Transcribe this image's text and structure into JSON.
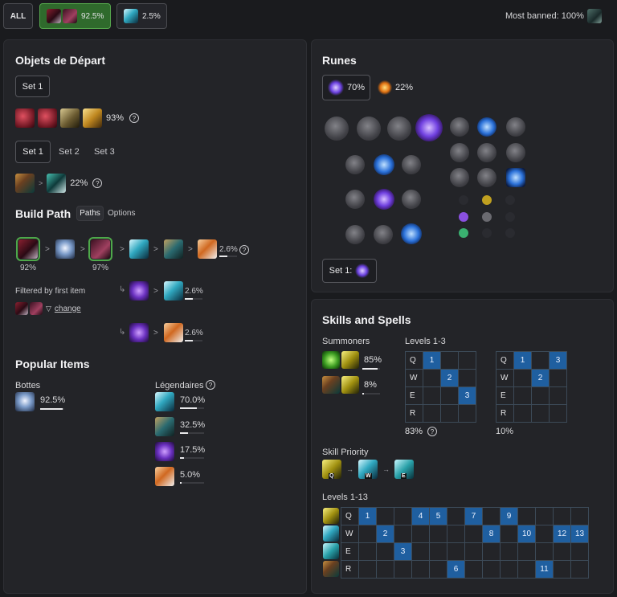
{
  "filters": {
    "all_label": "ALL",
    "filter1_pct": "92.5%",
    "filter2_pct": "2.5%",
    "most_banned": "Most banned: 100%"
  },
  "starting": {
    "title": "Objets de Départ",
    "set_button": "Set 1",
    "items_pct": "93%",
    "tabs": [
      "Set 1",
      "Set 2",
      "Set 3"
    ],
    "combo_pct": "22%",
    "combo_sep": ">"
  },
  "build": {
    "title": "Build Path",
    "tab_paths": "Paths",
    "tab_options": "Options",
    "pct1": "92%",
    "pct2": "97%",
    "main_pct": "2.6%",
    "sep": ">",
    "filtered_label": "Filtered by first item",
    "change": "change",
    "alt1_pct": "2.6%",
    "alt2_pct": "2.6%"
  },
  "popular": {
    "title": "Popular Items",
    "boots_title": "Bottes",
    "boots_pct": "92.5%",
    "legend_title": "Légendaires",
    "legend": [
      {
        "pct": "70.0%",
        "icon": "storm-blade-icon",
        "fill": 0.7
      },
      {
        "pct": "32.5%",
        "icon": "eel-blade-icon",
        "fill": 0.33
      },
      {
        "pct": "17.5%",
        "icon": "void-staff-icon",
        "fill": 0.18
      },
      {
        "pct": "5.0%",
        "icon": "guardian-angel-icon",
        "fill": 0.05
      }
    ]
  },
  "runes": {
    "title": "Runes",
    "page1_pct": "70%",
    "page2_pct": "22%",
    "set_label": "Set 1:"
  },
  "skills": {
    "title": "Skills and Spells",
    "summoners_label": "Summoners",
    "summ1_pct": "85%",
    "summ2_pct": "8%",
    "levels13_label": "Levels 1-3",
    "grid_a_pct": "83%",
    "grid_b_pct": "10%",
    "priority_label": "Skill Priority",
    "priority": [
      "Q",
      "W",
      "E"
    ],
    "levels113_label": "Levels 1-13",
    "keys": [
      "Q",
      "W",
      "E",
      "R"
    ],
    "grid_a": {
      "Q": [
        1
      ],
      "W": [
        2
      ],
      "E": [
        3
      ],
      "R": []
    },
    "grid_b": {
      "Q": [
        1,
        3
      ],
      "W": [
        2
      ],
      "E": [],
      "R": []
    },
    "grid_full": {
      "Q": [
        1,
        4,
        5,
        7,
        9
      ],
      "W": [
        2,
        8,
        10,
        12,
        13
      ],
      "E": [
        3
      ],
      "R": [
        6,
        11
      ]
    }
  },
  "colors": {
    "accent_green": "#4ea84a",
    "skill_blue": "#1f5fa0"
  }
}
